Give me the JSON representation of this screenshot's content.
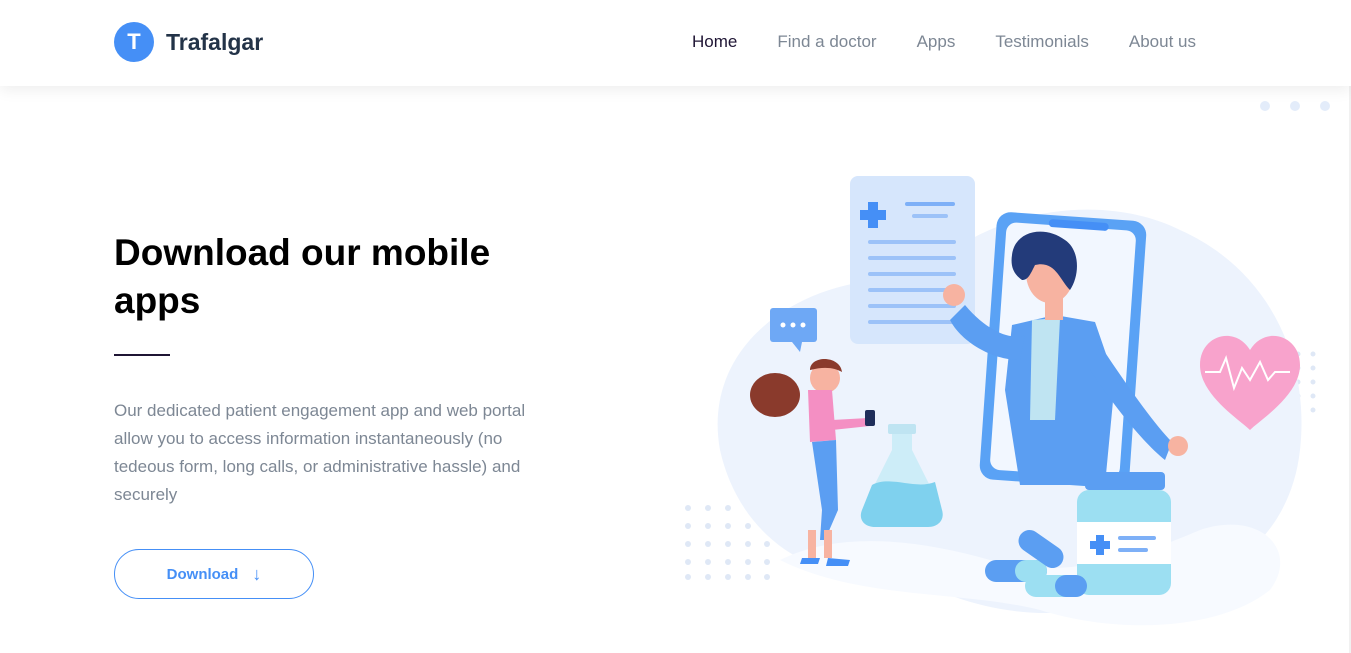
{
  "brand": {
    "letter": "T",
    "name": "Trafalgar"
  },
  "nav": {
    "items": [
      {
        "label": "Home",
        "active": true
      },
      {
        "label": "Find a doctor",
        "active": false
      },
      {
        "label": "Apps",
        "active": false
      },
      {
        "label": "Testimonials",
        "active": false
      },
      {
        "label": "About us",
        "active": false
      }
    ]
  },
  "hero": {
    "title": "Download our mobile apps",
    "description": "Our dedicated patient engagement app and web portal allow you to access information instantaneously (no tedeous form, long calls, or administrative hassle) and securely",
    "button_label": "Download",
    "button_icon": "arrow-down-icon"
  },
  "colors": {
    "accent": "#458ff6",
    "heading": "#000000",
    "body_text": "#7d8794",
    "logo_text": "#233348"
  },
  "illustration": {
    "icon": "doctor-phone-illustration"
  }
}
